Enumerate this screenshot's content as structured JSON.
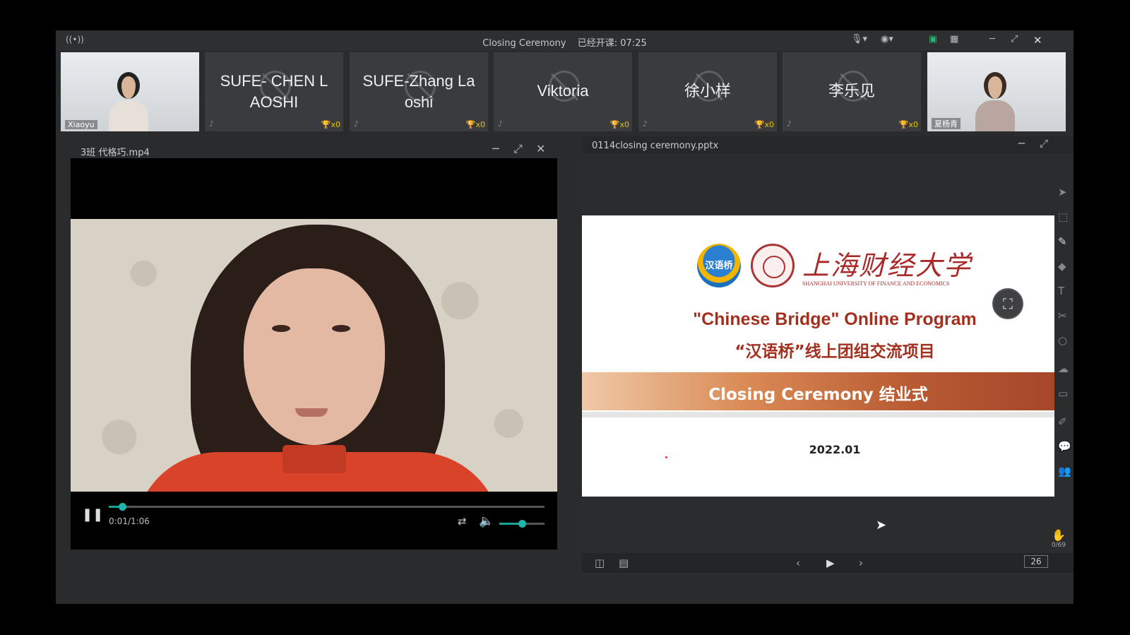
{
  "window": {
    "title": "Closing Ceremony",
    "elapsed_label": "已经开课: 07:25"
  },
  "participants": [
    {
      "name": "",
      "tag": "Xiaoyu",
      "camera": true
    },
    {
      "name": "SUFE- CHEN L AOSHI",
      "trophies": "x0",
      "camera": false
    },
    {
      "name": "SUFE-Zhang La oshi",
      "trophies": "x0",
      "camera": false
    },
    {
      "name": "Viktoria",
      "trophies": "x0",
      "camera": false
    },
    {
      "name": "徐小样",
      "trophies": "x0",
      "camera": false
    },
    {
      "name": "李乐见",
      "trophies": "x0",
      "camera": false
    },
    {
      "name": "",
      "tag": "夏杨青",
      "camera": true
    }
  ],
  "video_window": {
    "filename": "3班 代格巧.mp4",
    "time": "0:01/1:06",
    "progress": 0.03,
    "volume": 0.5
  },
  "presentation": {
    "filename": "0114closing ceremony.pptx",
    "slide": {
      "logo_text": "汉语桥",
      "university_cn": "上海财经大学",
      "university_en": "SHANGHAI UNIVERSITY OF FINANCE AND ECONOMICS",
      "title_en": "\"Chinese Bridge\" Online Program",
      "title_cn": "“汉语桥”线上团组交流项目",
      "banner": "Closing Ceremony  结业式",
      "date": "2022.01"
    },
    "hand_count": "0/69",
    "page": "26"
  }
}
